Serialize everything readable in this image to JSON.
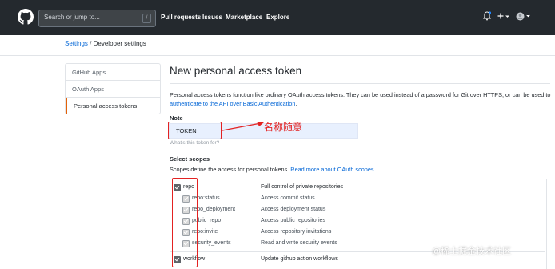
{
  "header": {
    "search_placeholder": "Search or jump to...",
    "search_shortcut": "/",
    "nav": [
      "Pull requests",
      "Issues",
      "Marketplace",
      "Explore"
    ],
    "icons": [
      "github-logo-icon",
      "bell-icon",
      "plus-icon",
      "avatar-icon"
    ]
  },
  "breadcrumb": {
    "parent": "Settings",
    "separator": "/",
    "current": "Developer settings"
  },
  "sidebar": {
    "items": [
      {
        "label": "GitHub Apps"
      },
      {
        "label": "OAuth Apps"
      },
      {
        "label": "Personal access tokens",
        "selected": true
      }
    ]
  },
  "main": {
    "title": "New personal access token",
    "description_pre": "Personal access tokens function like ordinary OAuth access tokens. They can be used instead of a password for Git over HTTPS, or can be used to ",
    "description_link": "authenticate to the API over Basic Authentication",
    "description_post": ".",
    "note_label": "Note",
    "note_value": "TOKEN",
    "note_hint": "What's this token for?",
    "annotation": "名称随意",
    "scopes_label": "Select scopes",
    "scopes_desc_pre": "Scopes define the access for personal tokens. ",
    "scopes_desc_link": "Read more about OAuth scopes.",
    "scopes": [
      {
        "name": "repo",
        "desc": "Full control of private repositories",
        "level": "main",
        "checked": true
      },
      {
        "name": "repo:status",
        "desc": "Access commit status",
        "level": "sub",
        "checked": true
      },
      {
        "name": "repo_deployment",
        "desc": "Access deployment status",
        "level": "sub",
        "checked": true
      },
      {
        "name": "public_repo",
        "desc": "Access public repositories",
        "level": "sub",
        "checked": true
      },
      {
        "name": "repo:invite",
        "desc": "Access repository invitations",
        "level": "sub",
        "checked": true
      },
      {
        "name": "security_events",
        "desc": "Read and write security events",
        "level": "sub",
        "checked": true
      },
      {
        "name": "workflow",
        "desc": "Update github action workflows",
        "level": "main",
        "checked": true
      }
    ]
  },
  "watermark": "@稀土掘金技术社区",
  "colors": {
    "header_bg": "#24292e",
    "link": "#0366d6",
    "annotation_red": "#e32222",
    "selected_accent": "#e36209",
    "input_autofill": "#e8f0fe"
  }
}
